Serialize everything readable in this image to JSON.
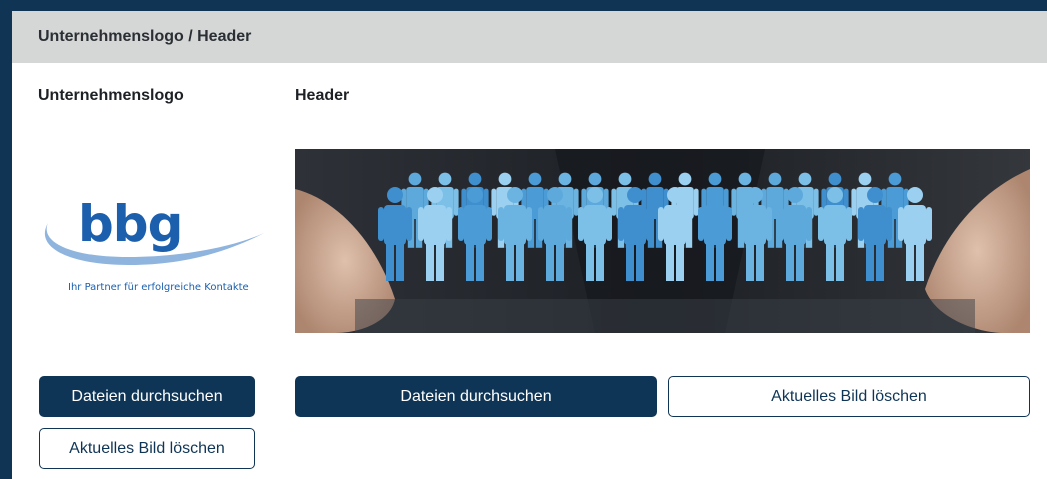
{
  "panel": {
    "title": "Unternehmenslogo / Header"
  },
  "logo_section": {
    "label": "Unternehmenslogo",
    "logo": {
      "wordmark": "bbg",
      "tagline": "Ihr Partner für erfolgreiche Kontakte"
    },
    "browse_button": "Dateien durchsuchen",
    "delete_button": "Aktuelles Bild löschen"
  },
  "header_section": {
    "label": "Header",
    "browse_button": "Dateien durchsuchen",
    "delete_button": "Aktuelles Bild löschen"
  },
  "colors": {
    "page_background": "#0f3454",
    "header_bar": "#d5d7d7",
    "primary_button": "#0f3556",
    "logo_blue": "#1b5fad",
    "logo_swoosh": "#8fb4de"
  }
}
